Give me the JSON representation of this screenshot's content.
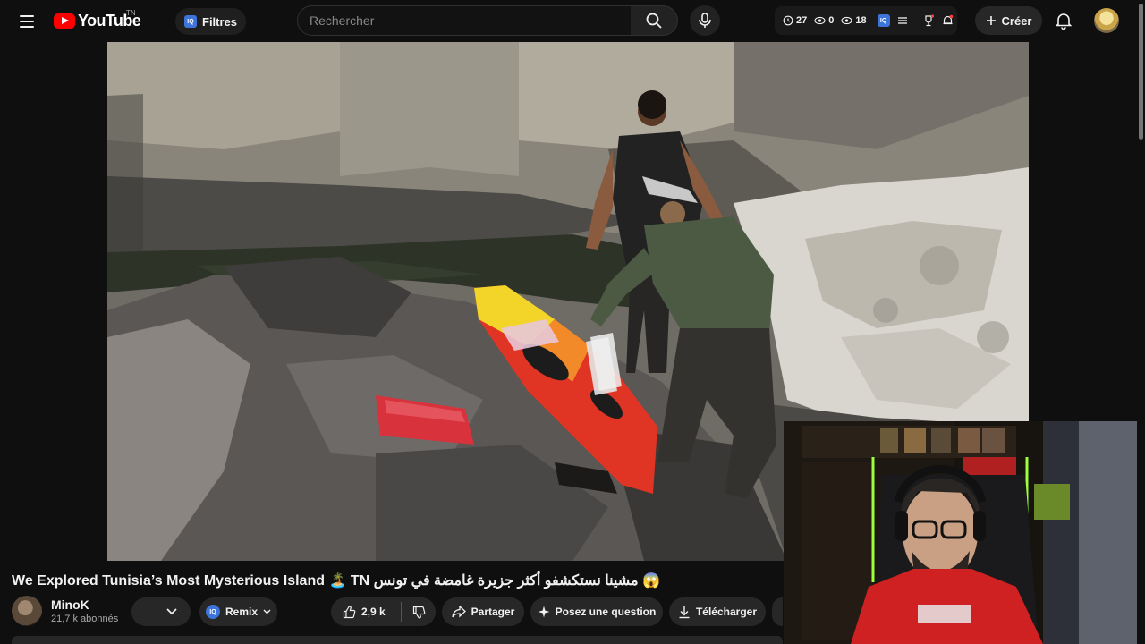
{
  "header": {
    "logo_text": "YouTube",
    "country_code": "TN",
    "filters_label": "Filtres",
    "search_placeholder": "Rechercher",
    "extension_stats": {
      "thumbs": "27",
      "views": "0",
      "eyes": "18"
    },
    "create_label": "Créer",
    "iq_badge": "IQ"
  },
  "video": {
    "title": "We Explored Tunisia’s Most Mysterious Island 🏝️ TN مشينا نستكشفو أكثر جزيرة غامضة في تونس 😱"
  },
  "channel": {
    "name": "MinoK",
    "subscribers": "21,7 k abonnés"
  },
  "actions": {
    "remix_label": "Remix",
    "like_count": "2,9 k",
    "share_label": "Partager",
    "ask_label": "Posez une question",
    "download_label": "Télécharger"
  },
  "colors": {
    "brand_red": "#ff0000",
    "background": "#0f0f0f",
    "pill": "#272727",
    "iq_blue": "#3d74d9"
  },
  "icons": [
    "menu-icon",
    "youtube-logo-icon",
    "search-icon",
    "mic-icon",
    "thumb-icon",
    "views-icon",
    "eye-icon",
    "list-icon",
    "trophy-icon",
    "bell-icon",
    "plus-icon",
    "chevron-down-icon",
    "like-icon",
    "dislike-icon",
    "share-icon",
    "sparkle-icon",
    "download-icon"
  ]
}
